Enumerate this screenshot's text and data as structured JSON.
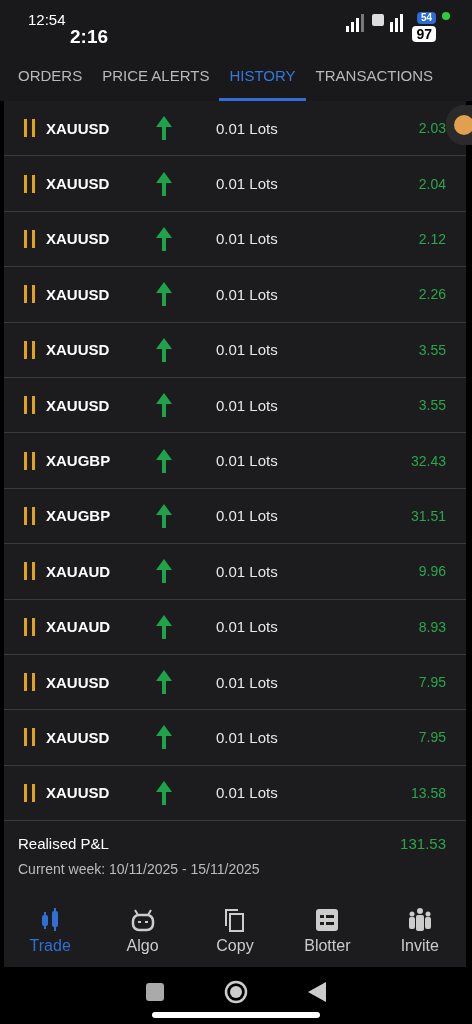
{
  "status_bar": {
    "time": "12:54",
    "secondary_time": "2:16",
    "battery_small": "54",
    "battery": "97"
  },
  "tabs": [
    {
      "label": "ORDERS",
      "selected": false
    },
    {
      "label": "PRICE ALERTS",
      "selected": false
    },
    {
      "label": "HISTORY",
      "selected": true
    },
    {
      "label": "TRANSACTIONS",
      "selected": false
    }
  ],
  "trades": [
    {
      "symbol": "XAUUSD",
      "volume": "0.01 Lots",
      "pnl": "2.03"
    },
    {
      "symbol": "XAUUSD",
      "volume": "0.01 Lots",
      "pnl": "2.04"
    },
    {
      "symbol": "XAUUSD",
      "volume": "0.01 Lots",
      "pnl": "2.12"
    },
    {
      "symbol": "XAUUSD",
      "volume": "0.01 Lots",
      "pnl": "2.26"
    },
    {
      "symbol": "XAUUSD",
      "volume": "0.01 Lots",
      "pnl": "3.55"
    },
    {
      "symbol": "XAUUSD",
      "volume": "0.01 Lots",
      "pnl": "3.55"
    },
    {
      "symbol": "XAUGBP",
      "volume": "0.01 Lots",
      "pnl": "32.43"
    },
    {
      "symbol": "XAUGBP",
      "volume": "0.01 Lots",
      "pnl": "31.51"
    },
    {
      "symbol": "XAUAUD",
      "volume": "0.01 Lots",
      "pnl": "9.96"
    },
    {
      "symbol": "XAUAUD",
      "volume": "0.01 Lots",
      "pnl": "8.93"
    },
    {
      "symbol": "XAUUSD",
      "volume": "0.01 Lots",
      "pnl": "7.95"
    },
    {
      "symbol": "XAUUSD",
      "volume": "0.01 Lots",
      "pnl": "7.95"
    },
    {
      "symbol": "XAUUSD",
      "volume": "0.01 Lots",
      "pnl": "13.58"
    }
  ],
  "summary": {
    "label": "Realised P&L",
    "value": "131.53",
    "period": "Current week: 10/11/2025 - 15/11/2025"
  },
  "bottom_nav": [
    {
      "label": "Trade",
      "selected": true
    },
    {
      "label": "Algo",
      "selected": false
    },
    {
      "label": "Copy",
      "selected": false
    },
    {
      "label": "Blotter",
      "selected": false
    },
    {
      "label": "Invite",
      "selected": false
    }
  ]
}
